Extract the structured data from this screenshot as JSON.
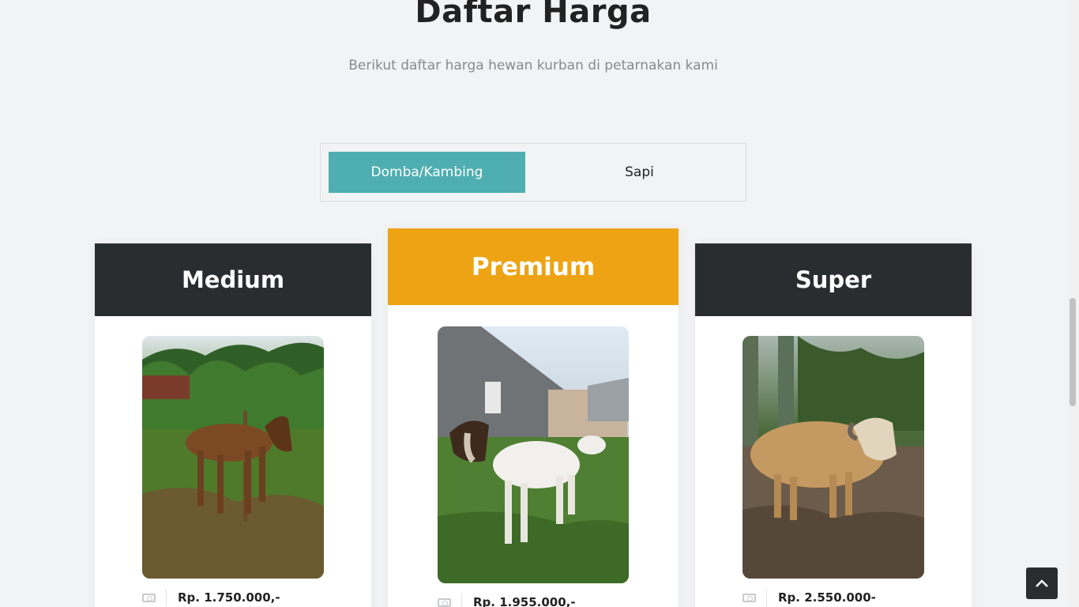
{
  "header": {
    "title": "Daftar Harga",
    "subtitle": "Berikut daftar harga hewan kurban di petarnakan kami"
  },
  "tabs": [
    {
      "label": "Domba/Kambing",
      "active": true
    },
    {
      "label": "Sapi",
      "active": false
    }
  ],
  "cards": [
    {
      "title": "Medium",
      "price": "Rp. 1.750.000,-",
      "photo_icon": "goat-photo",
      "header_color": "#2a2d30"
    },
    {
      "title": "Premium",
      "price": "Rp. 1.955.000,-",
      "photo_icon": "goat-photo",
      "header_color": "#eda313"
    },
    {
      "title": "Super",
      "price": "Rp. 2.550.000-",
      "photo_icon": "sheep-photo",
      "header_color": "#2a2d30"
    }
  ],
  "colors": {
    "accent": "#4faeb1",
    "gold": "#eda313",
    "dark": "#2a2d30"
  },
  "back_to_top_icon": "chevron-up-icon",
  "price_icon": "money-icon"
}
